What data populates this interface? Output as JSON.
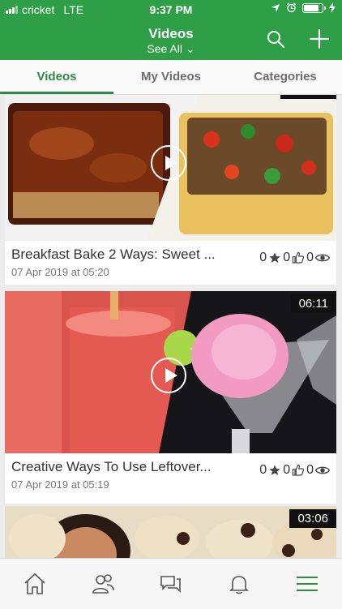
{
  "status_bar": {
    "carrier": "cricket",
    "network": "LTE",
    "time": "9:37 PM",
    "battery_level": 0.85
  },
  "header": {
    "title": "Videos",
    "subtitle": "See All ⌄",
    "accent": "#2e9e47"
  },
  "tabs": [
    {
      "label": "Videos",
      "active": true
    },
    {
      "label": "My Videos",
      "active": false
    },
    {
      "label": "Categories",
      "active": false
    }
  ],
  "videos": [
    {
      "title": "Breakfast Bake 2 Ways: Sweet ...",
      "date": "07 Apr 2019 at 05:20",
      "ratings": "0",
      "likes": "0",
      "views": "0",
      "duration": ""
    },
    {
      "title": "Creative Ways To Use Leftover...",
      "date": "07 Apr 2019 at 05:19",
      "ratings": "0",
      "likes": "0",
      "views": "0",
      "duration": "06:11"
    },
    {
      "title": "",
      "date": "",
      "ratings": "",
      "likes": "",
      "views": "",
      "duration": "03:06"
    }
  ],
  "bottom_nav": [
    "home-icon",
    "users-icon",
    "chat-icon",
    "bell-icon",
    "menu-icon"
  ]
}
